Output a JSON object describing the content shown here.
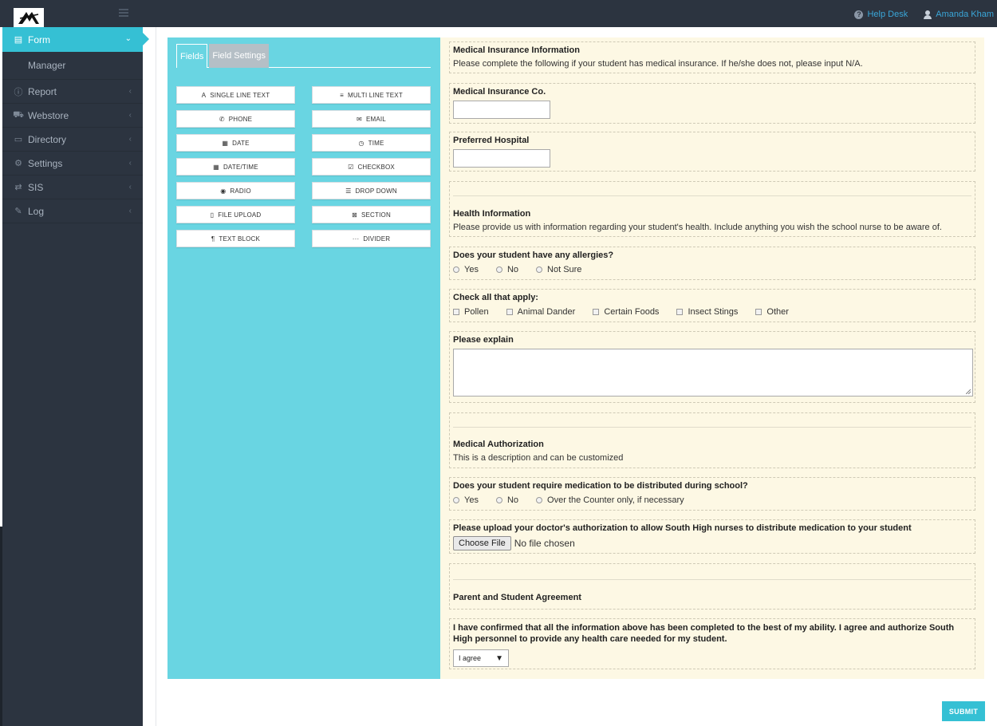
{
  "topbar": {
    "help_label": "Help Desk",
    "user_label": "Amanda Kham"
  },
  "sidebar": {
    "items": [
      {
        "label": "Form",
        "icon": "document-icon",
        "active": true
      },
      {
        "label": "Manager",
        "sub": true
      },
      {
        "label": "Report",
        "icon": "info-icon"
      },
      {
        "label": "Webstore",
        "icon": "cart-icon"
      },
      {
        "label": "Directory",
        "icon": "folder-icon"
      },
      {
        "label": "Settings",
        "icon": "gear-icon"
      },
      {
        "label": "SIS",
        "icon": "exchange-icon"
      },
      {
        "label": "Log",
        "icon": "wrench-icon"
      }
    ]
  },
  "builder": {
    "tabs": [
      {
        "label": "Fields",
        "active": true
      },
      {
        "label": "Field Settings",
        "active": false
      }
    ],
    "field_buttons": [
      {
        "label": "SINGLE LINE TEXT",
        "icon": "A"
      },
      {
        "label": "MULTI LINE TEXT",
        "icon": "≡"
      },
      {
        "label": "PHONE",
        "icon": "✆"
      },
      {
        "label": "EMAIL",
        "icon": "✉"
      },
      {
        "label": "DATE",
        "icon": "▦"
      },
      {
        "label": "TIME",
        "icon": "◷"
      },
      {
        "label": "DATE/TIME",
        "icon": "▦"
      },
      {
        "label": "CHECKBOX",
        "icon": "☑"
      },
      {
        "label": "RADIO",
        "icon": "◉"
      },
      {
        "label": "DROP DOWN",
        "icon": "☰"
      },
      {
        "label": "FILE UPLOAD",
        "icon": "▯"
      },
      {
        "label": "SECTION",
        "icon": "⊠"
      },
      {
        "label": "TEXT BLOCK",
        "icon": "¶"
      },
      {
        "label": "DIVIDER",
        "icon": "···"
      }
    ]
  },
  "form": {
    "s1": {
      "title": "Medical Insurance Information",
      "desc": "Please complete the following if your student has medical insurance. If he/she does not, please input N/A."
    },
    "s2": {
      "title": "Medical Insurance Co."
    },
    "s3": {
      "title": "Preferred Hospital"
    },
    "s4": {
      "title": "Health Information",
      "desc": "Please provide us with information regarding your student's health. Include anything you wish the school nurse to be aware of."
    },
    "s5": {
      "title": "Does your student have any allergies?",
      "options": [
        "Yes",
        "No",
        "Not Sure"
      ]
    },
    "s6": {
      "title": "Check all that apply:",
      "options": [
        "Pollen",
        "Animal Dander",
        "Certain Foods",
        "Insect Stings",
        "Other"
      ]
    },
    "s7": {
      "title": "Please explain"
    },
    "s8": {
      "title": "Medical Authorization",
      "desc": "This is a description and can be customized"
    },
    "s9": {
      "title": "Does your student require medication to be distributed during school?",
      "options": [
        "Yes",
        "No",
        "Over the Counter only, if necessary"
      ]
    },
    "s10": {
      "title": "Please upload your doctor's authorization to allow South High nurses to distribute medication to your student",
      "file_button": "Choose File",
      "file_status": "No file chosen"
    },
    "s11": {
      "title": "Parent and Student Agreement"
    },
    "s12": {
      "title": "I have confirmed that all the information above has been completed to the best of my ability. I agree and authorize South High personnel to provide any health care needed for my student.",
      "select_value": "I agree"
    }
  },
  "submit_label": "SUBMIT",
  "colors": {
    "accent": "#35c0d4",
    "panel": "#69d5e2",
    "sidebar": "#2c3440",
    "form_bg": "#fdf8e4"
  }
}
